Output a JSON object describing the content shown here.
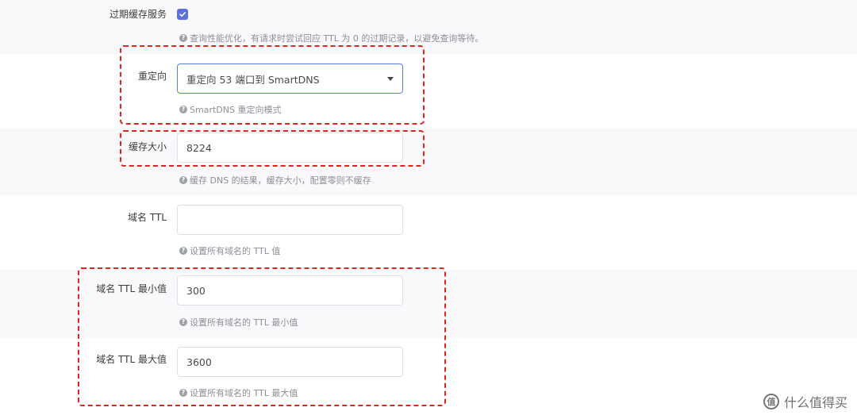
{
  "rows": {
    "expired_cache": {
      "label": "过期缓存服务",
      "checked": true,
      "help": "查询性能优化，有请求时尝试回应 TTL 为 0 的过期记录，以避免查询等待。"
    },
    "redirect": {
      "label": "重定向",
      "value": "重定向 53 端口到 SmartDNS",
      "help": "SmartDNS 重定向模式"
    },
    "cache_size": {
      "label": "缓存大小",
      "value": "8224",
      "help": "缓存 DNS 的结果，缓存大小，配置零则不缓存"
    },
    "domain_ttl": {
      "label": "域名 TTL",
      "value": "",
      "help": "设置所有域名的 TTL 值"
    },
    "domain_ttl_min": {
      "label": "域名 TTL 最小值",
      "value": "300",
      "help": "设置所有域名的 TTL 最小值"
    },
    "domain_ttl_max": {
      "label": "域名 TTL 最大值",
      "value": "3600",
      "help": "设置所有域名的 TTL 最大值"
    }
  },
  "watermark": {
    "text": "什么值得买",
    "icon": "zhi-logo-icon"
  },
  "colors": {
    "accent": "#5b6fe0",
    "highlight": "#e0241f",
    "band": "#f9f9fb",
    "help_text": "#8c8f96"
  }
}
